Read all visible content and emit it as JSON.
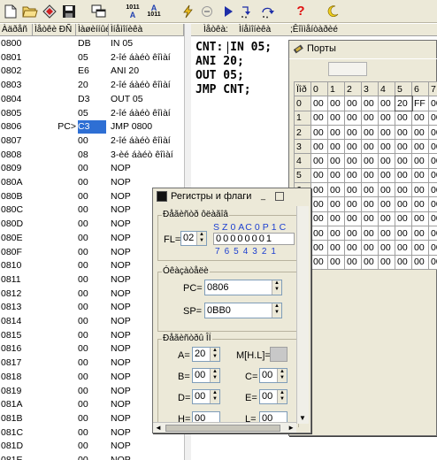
{
  "toolbar": {
    "icons": [
      "new-file-icon",
      "open-folder-icon",
      "bookmark-icon",
      "save-icon",
      "windows-icon",
      "assemble-icon",
      "disassemble-icon",
      "compile-icon",
      "stop-icon",
      "run-icon",
      "step-into-icon",
      "step-over-icon",
      "help-icon",
      "moon-icon"
    ],
    "assemble_label_top": "1011",
    "assemble_label_bottom": "A",
    "disassemble_label_top": "A",
    "disassemble_label_bottom": "1011"
  },
  "listing": {
    "headers": {
      "addr": "Àäðåñ",
      "label": "Ìåòêè ÐÑ",
      "code": "Ìàøèííûé",
      "mnemonic": "Ìíåìîíèêà"
    },
    "rows": [
      {
        "addr": "0800",
        "label": "",
        "code": "DB",
        "mn": "IN  05"
      },
      {
        "addr": "0801",
        "label": "",
        "code": "05",
        "mn": "2-îé áàéò êîìàí"
      },
      {
        "addr": "0802",
        "label": "",
        "code": "E6",
        "mn": "ANI  20"
      },
      {
        "addr": "0803",
        "label": "",
        "code": "20",
        "mn": "2-îé áàéò êîìàí"
      },
      {
        "addr": "0804",
        "label": "",
        "code": "D3",
        "mn": "OUT  05"
      },
      {
        "addr": "0805",
        "label": "",
        "code": "05",
        "mn": "2-îé áàéò êîìàí"
      },
      {
        "addr": "0806",
        "label": "PC>",
        "code": "C3",
        "mn": "JMP  0800"
      },
      {
        "addr": "0807",
        "label": "",
        "code": "00",
        "mn": "2-îé áàéò êîìàí"
      },
      {
        "addr": "0808",
        "label": "",
        "code": "08",
        "mn": "3-èé áàéò êîìàí"
      },
      {
        "addr": "0809",
        "label": "",
        "code": "00",
        "mn": "NOP"
      },
      {
        "addr": "080A",
        "label": "",
        "code": "00",
        "mn": "NOP"
      },
      {
        "addr": "080B",
        "label": "",
        "code": "00",
        "mn": "NOP"
      },
      {
        "addr": "080C",
        "label": "",
        "code": "00",
        "mn": "NOP"
      },
      {
        "addr": "080D",
        "label": "",
        "code": "00",
        "mn": "NOP"
      },
      {
        "addr": "080E",
        "label": "",
        "code": "00",
        "mn": "NOP"
      },
      {
        "addr": "080F",
        "label": "",
        "code": "00",
        "mn": "NOP"
      },
      {
        "addr": "0810",
        "label": "",
        "code": "00",
        "mn": "NOP"
      },
      {
        "addr": "0811",
        "label": "",
        "code": "00",
        "mn": "NOP"
      },
      {
        "addr": "0812",
        "label": "",
        "code": "00",
        "mn": "NOP"
      },
      {
        "addr": "0813",
        "label": "",
        "code": "00",
        "mn": "NOP"
      },
      {
        "addr": "0814",
        "label": "",
        "code": "00",
        "mn": "NOP"
      },
      {
        "addr": "0815",
        "label": "",
        "code": "00",
        "mn": "NOP"
      },
      {
        "addr": "0816",
        "label": "",
        "code": "00",
        "mn": "NOP"
      },
      {
        "addr": "0817",
        "label": "",
        "code": "00",
        "mn": "NOP"
      },
      {
        "addr": "0818",
        "label": "",
        "code": "00",
        "mn": "NOP"
      },
      {
        "addr": "0819",
        "label": "",
        "code": "00",
        "mn": "NOP"
      },
      {
        "addr": "081A",
        "label": "",
        "code": "00",
        "mn": "NOP"
      },
      {
        "addr": "081B",
        "label": "",
        "code": "00",
        "mn": "NOP"
      },
      {
        "addr": "081C",
        "label": "",
        "code": "00",
        "mn": "NOP"
      },
      {
        "addr": "081D",
        "label": "",
        "code": "00",
        "mn": "NOP"
      },
      {
        "addr": "081E",
        "label": "",
        "code": "00",
        "mn": "NOP"
      }
    ],
    "highlight_color": "#2e6fd4"
  },
  "editor": {
    "headers": {
      "label": "Ìåòêà:",
      "mnemonic": "Ìíåìîíèêà",
      "comment": ";Êîììåíòàðèé"
    },
    "lines": [
      "CNT: IN 05;",
      "ANI 20;",
      "OUT 05;",
      "JMP CNT;"
    ]
  },
  "ports": {
    "title": "Порты",
    "col_headers": [
      "Ïîð",
      "0",
      "1",
      "2",
      "3",
      "4",
      "5",
      "6",
      "7"
    ],
    "rows": [
      {
        "h": "0",
        "v": [
          "00",
          "00",
          "00",
          "00",
          "00",
          "20",
          "FF",
          "00"
        ]
      },
      {
        "h": "1",
        "v": [
          "00",
          "00",
          "00",
          "00",
          "00",
          "00",
          "00",
          "00"
        ]
      },
      {
        "h": "2",
        "v": [
          "00",
          "00",
          "00",
          "00",
          "00",
          "00",
          "00",
          "00"
        ]
      },
      {
        "h": "3",
        "v": [
          "00",
          "00",
          "00",
          "00",
          "00",
          "00",
          "00",
          "00"
        ]
      },
      {
        "h": "4",
        "v": [
          "00",
          "00",
          "00",
          "00",
          "00",
          "00",
          "00",
          "00"
        ]
      },
      {
        "h": "5",
        "v": [
          "00",
          "00",
          "00",
          "00",
          "00",
          "00",
          "00",
          "00"
        ]
      },
      {
        "h": "6",
        "v": [
          "00",
          "00",
          "00",
          "00",
          "00",
          "00",
          "00",
          "00"
        ]
      },
      {
        "h": "7",
        "v": [
          "00",
          "00",
          "00",
          "00",
          "00",
          "00",
          "00",
          "00"
        ]
      },
      {
        "h": "8",
        "v": [
          "00",
          "00",
          "00",
          "00",
          "00",
          "00",
          "00",
          "00"
        ]
      },
      {
        "h": "9",
        "v": [
          "00",
          "00",
          "00",
          "00",
          "00",
          "00",
          "00",
          "00"
        ]
      },
      {
        "h": "A",
        "v": [
          "00",
          "00",
          "00",
          "00",
          "00",
          "00",
          "00",
          "00"
        ]
      },
      {
        "h": "B",
        "v": [
          "00",
          "00",
          "00",
          "00",
          "00",
          "00",
          "00",
          "00"
        ]
      }
    ]
  },
  "registers": {
    "title": "Регистры и флаги",
    "flags_group": "Ðåãèñòð ôëàãîâ",
    "flag_names": [
      "S",
      "Z",
      "0",
      "AC",
      "0",
      "P",
      "1",
      "C"
    ],
    "fl_label": "FL=",
    "fl_value": "02",
    "flag_bits": "00000001",
    "bit_numbers": [
      "7",
      "6",
      "5",
      "4",
      "3",
      "2",
      "1"
    ],
    "pointers_group": "Óêàçàòåëè",
    "pc_label": "PC=",
    "pc_value": "0806",
    "sp_label": "SP=",
    "sp_value": "0BB0",
    "general_group": "Ðåãèñòðû ÎÍ",
    "a_label": "A=",
    "a_value": "20",
    "mhl_label": "M[H.L]=",
    "b_label": "B=",
    "b_value": "00",
    "c_label": "C=",
    "c_value": "00",
    "d_label": "D=",
    "d_value": "00",
    "e_label": "E=",
    "e_value": "00",
    "h_label": "H=",
    "h_value": "00",
    "l_label": "L=",
    "l_value": "00",
    "flag_color": "#1c3fd0"
  }
}
